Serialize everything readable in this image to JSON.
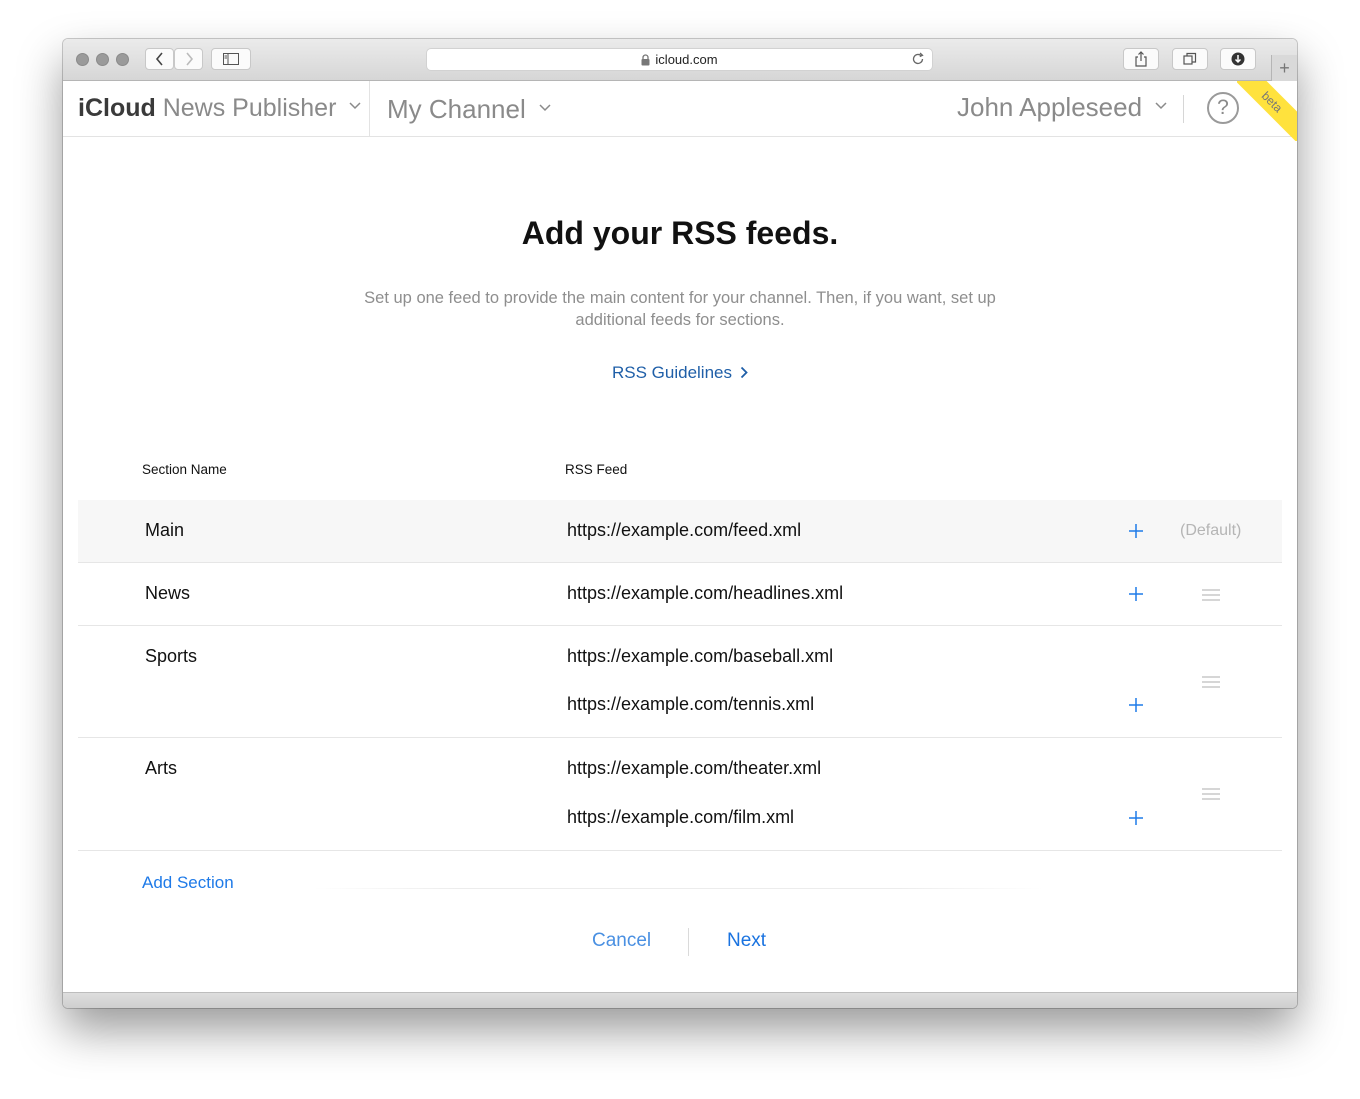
{
  "browser": {
    "url": "icloud.com",
    "new_tab_symbol": "+"
  },
  "header": {
    "brand_bold": "iCloud",
    "brand_light": "News Publisher",
    "channel": "My Channel",
    "user": "John Appleseed",
    "help_symbol": "?",
    "beta": "beta"
  },
  "page": {
    "title": "Add your RSS feeds.",
    "subtitle": "Set up one feed to provide the main content for your channel. Then, if you want, set up additional feeds for sections.",
    "guidelines_link": "RSS Guidelines"
  },
  "table": {
    "col_section": "Section Name",
    "col_feed": "RSS Feed",
    "rows": [
      {
        "name": "Main",
        "feeds": [
          "https://example.com/feed.xml"
        ],
        "default_label": "(Default)"
      },
      {
        "name": "News",
        "feeds": [
          "https://example.com/headlines.xml"
        ]
      },
      {
        "name": "Sports",
        "feeds": [
          "https://example.com/baseball.xml",
          "https://example.com/tennis.xml"
        ]
      },
      {
        "name": "Arts",
        "feeds": [
          "https://example.com/theater.xml",
          "https://example.com/film.xml"
        ]
      }
    ]
  },
  "actions": {
    "add_section": "Add Section",
    "cancel": "Cancel",
    "next": "Next"
  },
  "colors": {
    "link_blue": "#1e7ae8",
    "guidelines_blue": "#1f5fa8",
    "beta_yellow": "#ffe23d"
  }
}
